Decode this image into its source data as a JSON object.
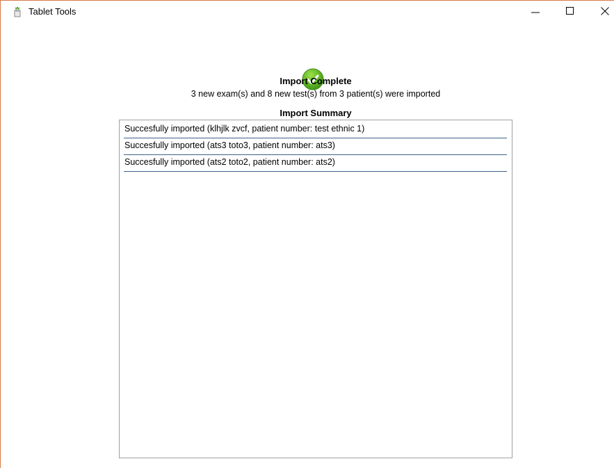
{
  "window": {
    "title": "Tablet Tools",
    "app_icon": "tablet-tools-app-icon",
    "controls": {
      "minimize_icon": "minimize-icon",
      "maximize_icon": "maximize-icon",
      "close_icon": "close-icon"
    },
    "border_color": "#d8794a"
  },
  "status": {
    "icon": "checkmark-success-icon",
    "icon_color": "#4caf1a",
    "title": "Import Complete",
    "detail": "3 new exam(s) and 8 new test(s) from 3 patient(s) were imported"
  },
  "summary": {
    "title": "Import Summary",
    "items": [
      "Succesfully imported (klhjlk zvcf, patient number: test ethnic 1)",
      "Succesfully imported (ats3 toto3, patient number: ats3)",
      "Succesfully imported (ats2 toto2, patient number: ats2)"
    ],
    "row_divider_color": "#3d5f8a"
  }
}
